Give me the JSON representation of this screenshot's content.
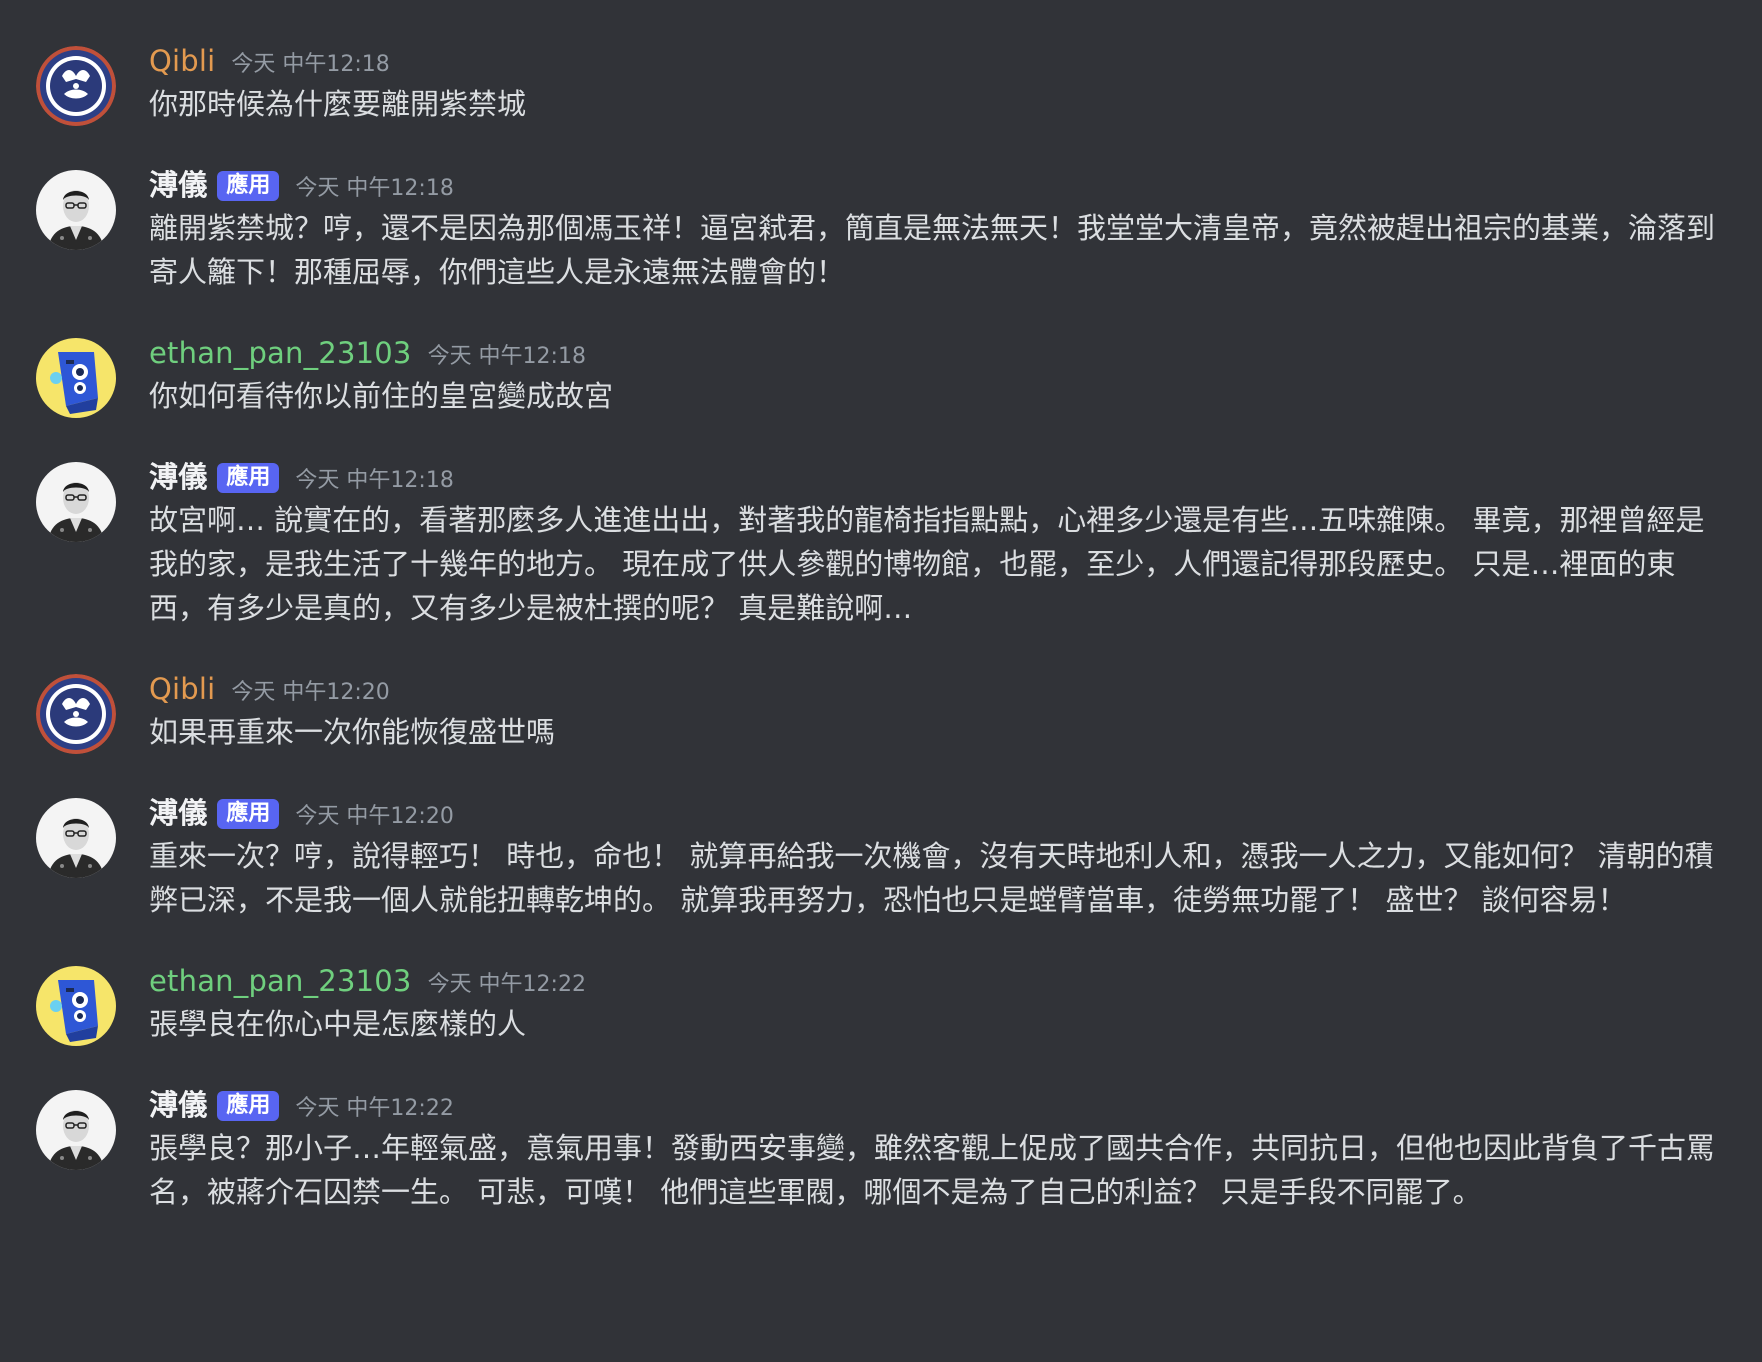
{
  "app": {
    "bg_color": "#313338"
  },
  "messages": [
    {
      "author": "Qibli",
      "author_color": "#e39a50",
      "avatar": "qibli-emblem-avatar",
      "badge": "",
      "timestamp": "今天 中午12:18",
      "content": "你那時候為什麼要離開紫禁城"
    },
    {
      "author": "溥儀",
      "author_color": "#f2f3f5",
      "avatar": "puyi-photo-avatar",
      "badge": "應用",
      "timestamp": "今天 中午12:18",
      "content": "離開紫禁城？哼，還不是因為那個馮玉祥！逼宮弒君，簡直是無法無天！我堂堂大清皇帝，竟然被趕出祖宗的基業，淪落到寄人籬下！那種屈辱，你們這些人是永遠無法體會的！"
    },
    {
      "author": "ethan_pan_23103",
      "author_color": "#6fcf7e",
      "avatar": "blue-robot-avatar",
      "badge": "",
      "timestamp": "今天 中午12:18",
      "content": "你如何看待你以前住的皇宮變成故宮"
    },
    {
      "author": "溥儀",
      "author_color": "#f2f3f5",
      "avatar": "puyi-photo-avatar",
      "badge": "應用",
      "timestamp": "今天 中午12:18",
      "content": "故宮啊… 說實在的，看著那麼多人進進出出，對著我的龍椅指指點點，心裡多少還是有些…五味雜陳。 畢竟，那裡曾經是我的家，是我生活了十幾年的地方。 現在成了供人參觀的博物館，也罷，至少，人們還記得那段歷史。 只是…裡面的東西，有多少是真的，又有多少是被杜撰的呢？ 真是難說啊…"
    },
    {
      "author": "Qibli",
      "author_color": "#e39a50",
      "avatar": "qibli-emblem-avatar",
      "badge": "",
      "timestamp": "今天 中午12:20",
      "content": "如果再重來一次你能恢復盛世嗎"
    },
    {
      "author": "溥儀",
      "author_color": "#f2f3f5",
      "avatar": "puyi-photo-avatar",
      "badge": "應用",
      "timestamp": "今天 中午12:20",
      "content": "重來一次？哼，說得輕巧！ 時也，命也！ 就算再給我一次機會，沒有天時地利人和，憑我一人之力，又能如何？ 清朝的積弊已深，不是我一個人就能扭轉乾坤的。 就算我再努力，恐怕也只是螳臂當車，徒勞無功罷了！ 盛世？ 談何容易！"
    },
    {
      "author": "ethan_pan_23103",
      "author_color": "#6fcf7e",
      "avatar": "blue-robot-avatar",
      "badge": "",
      "timestamp": "今天 中午12:22",
      "content": "張學良在你心中是怎麼樣的人"
    },
    {
      "author": "溥儀",
      "author_color": "#f2f3f5",
      "avatar": "puyi-photo-avatar",
      "badge": "應用",
      "timestamp": "今天 中午12:22",
      "content": "張學良？那小子…年輕氣盛，意氣用事！發動西安事變，雖然客觀上促成了國共合作，共同抗日，但他也因此背負了千古罵名，被蔣介石囚禁一生。 可悲，可嘆！ 他們這些軍閥，哪個不是為了自己的利益？ 只是手段不同罷了。"
    }
  ]
}
